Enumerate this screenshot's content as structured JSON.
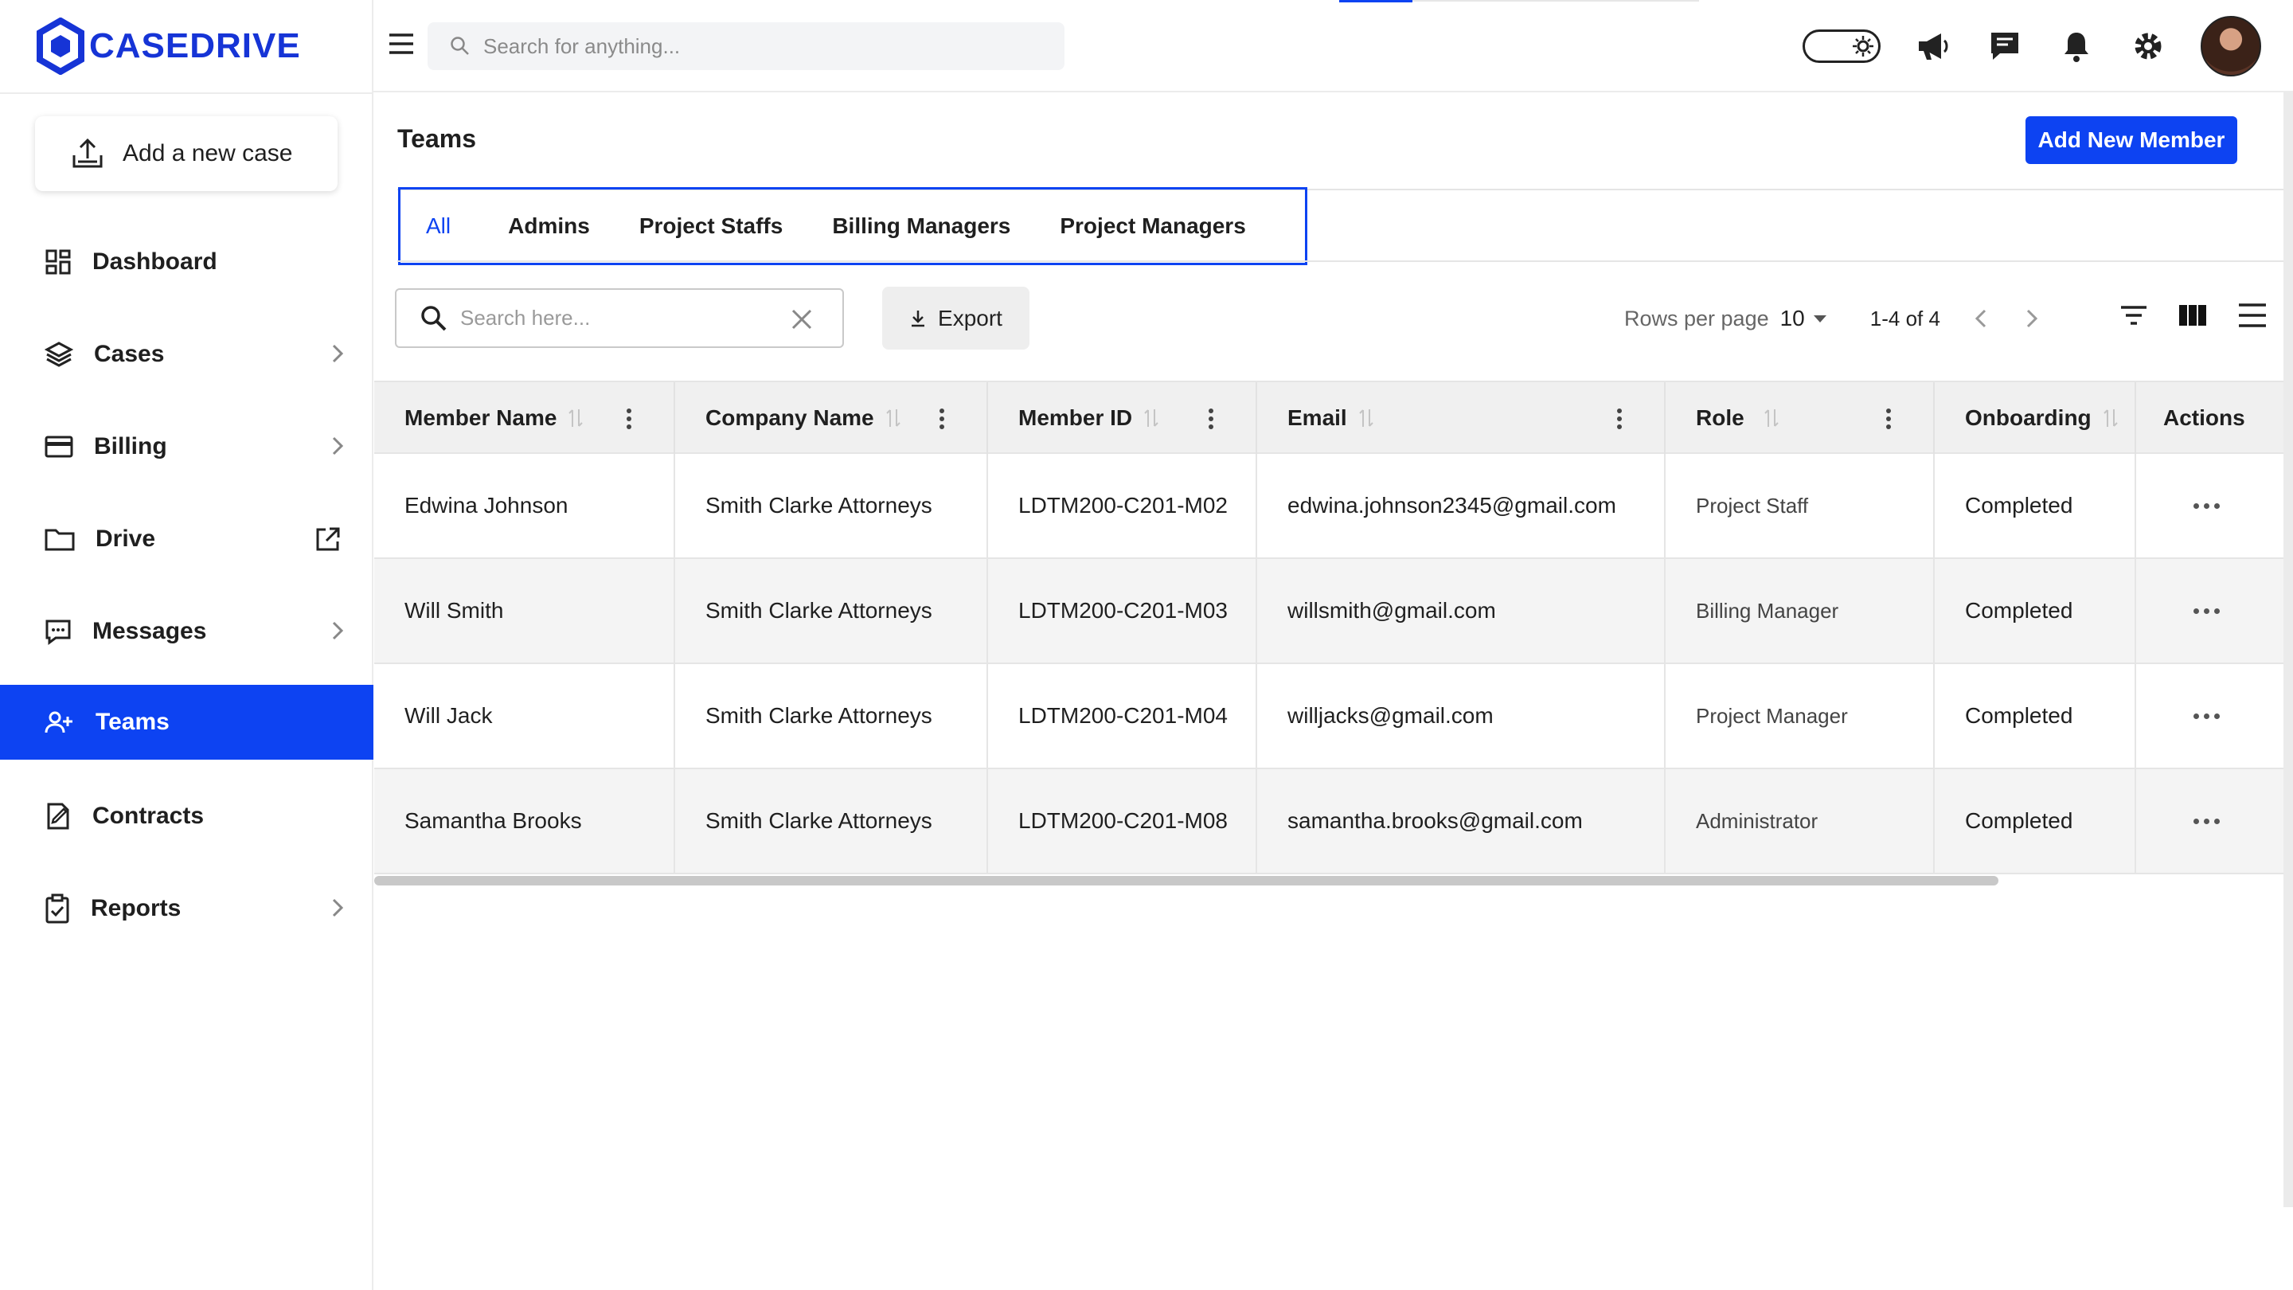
{
  "brand": {
    "name": "CASEDRIVE",
    "color": "#1634d6"
  },
  "accent": "#0d43f2",
  "sidebar": {
    "add_case_label": "Add a new case",
    "items": [
      {
        "label": "Dashboard",
        "icon": "dashboard-icon",
        "chevron": false
      },
      {
        "label": "Cases",
        "icon": "layers-icon",
        "chevron": true
      },
      {
        "label": "Billing",
        "icon": "credit-card-icon",
        "chevron": true
      },
      {
        "label": "Drive",
        "icon": "folder-icon",
        "external": true
      },
      {
        "label": "Messages",
        "icon": "message-icon",
        "chevron": true
      },
      {
        "label": "Teams",
        "icon": "team-icon",
        "active": true
      },
      {
        "label": "Contracts",
        "icon": "contract-icon",
        "chevron": false
      },
      {
        "label": "Reports",
        "icon": "clipboard-icon",
        "chevron": true
      }
    ]
  },
  "topbar": {
    "search_placeholder": "Search for anything..."
  },
  "page": {
    "title": "Teams",
    "add_member_label": "Add New Member",
    "tabs": [
      "All",
      "Admins",
      "Project Staffs",
      "Billing Managers",
      "Project Managers"
    ],
    "active_tab": "All"
  },
  "toolbar": {
    "search_placeholder": "Search here...",
    "export_label": "Export",
    "rows_per_page_label": "Rows per page",
    "rows_per_page_value": "10",
    "range_text": "1-4 of 4"
  },
  "table": {
    "columns": [
      "Member Name",
      "Company Name",
      "Member ID",
      "Email",
      "Role",
      "Onboarding",
      "Actions"
    ],
    "rows": [
      {
        "name": "Edwina Johnson",
        "company": "Smith Clarke Attorneys",
        "member_id": "LDTM200-C201-M02",
        "email": "edwina.johnson2345@gmail.com",
        "role": "Project Staff",
        "onboarding": "Completed"
      },
      {
        "name": "Will Smith",
        "company": "Smith Clarke Attorneys",
        "member_id": "LDTM200-C201-M03",
        "email": "willsmith@gmail.com",
        "role": "Billing Manager",
        "onboarding": "Completed"
      },
      {
        "name": "Will Jack",
        "company": "Smith Clarke Attorneys",
        "member_id": "LDTM200-C201-M04",
        "email": "willjacks@gmail.com",
        "role": "Project Manager",
        "onboarding": "Completed"
      },
      {
        "name": "Samantha Brooks",
        "company": "Smith Clarke Attorneys",
        "member_id": "LDTM200-C201-M08",
        "email": "samantha.brooks@gmail.com",
        "role": "Administrator",
        "onboarding": "Completed"
      }
    ]
  }
}
